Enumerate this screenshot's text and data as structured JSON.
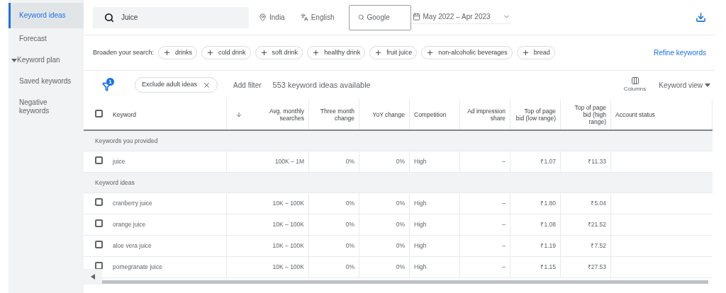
{
  "sidebar": {
    "items": [
      {
        "label": "Keyword ideas",
        "selected": true
      },
      {
        "label": "Forecast",
        "selected": false
      },
      {
        "label": "Keyword plan",
        "selected": false,
        "expanded": true
      },
      {
        "label": "Saved keywords",
        "selected": false
      },
      {
        "label": "Negative keywords",
        "selected": false
      }
    ]
  },
  "top_bar": {
    "search": {
      "value": "Juice"
    },
    "location": "India",
    "language": "English",
    "network": "Google",
    "date_range": "May 2022 – Apr 2023"
  },
  "broaden": {
    "label": "Broaden your search:",
    "chips": [
      "drinks",
      "cold drink",
      "soft drink",
      "healthy drink",
      "fruit juice",
      "non-alcoholic beverages",
      "bread"
    ],
    "refine": "Refine keywords"
  },
  "filter_bar": {
    "filter_count": "1",
    "chip": "Exclude adult ideas",
    "add_filter": "Add filter",
    "summary": "553 keyword ideas available",
    "columns": "Columns",
    "view": "Keyword view"
  },
  "table": {
    "select_all": {
      "checked": false
    },
    "columns": [
      "Keyword",
      "Avg. monthly searches",
      "Three month change",
      "YoY change",
      "Competition",
      "Ad impression share",
      "Top of page bid (low range)",
      "Top of page bid (high range)",
      "Account status"
    ],
    "rows": [
      {
        "kind": "group",
        "label": "Keywords you provided"
      },
      {
        "kind": "keyword",
        "checked": false,
        "cells": [
          "juice",
          "100K – 1M",
          "0%",
          "0%",
          "High",
          "–",
          "₹1.07",
          "₹11.33"
        ]
      },
      {
        "kind": "group",
        "label": "Keyword ideas"
      },
      {
        "kind": "keyword",
        "checked": false,
        "cells": [
          "cranberry juice",
          "10K – 100K",
          "0%",
          "0%",
          "High",
          "–",
          "₹1.80",
          "₹5.04"
        ]
      },
      {
        "kind": "keyword",
        "checked": false,
        "cells": [
          "orange juice",
          "10K – 100K",
          "0%",
          "0%",
          "High",
          "–",
          "₹1.08",
          "₹21.52"
        ]
      },
      {
        "kind": "keyword",
        "checked": false,
        "cells": [
          "aloe vera juice",
          "10K – 100K",
          "0%",
          "0%",
          "High",
          "–",
          "₹1.19",
          "₹7.52"
        ]
      },
      {
        "kind": "keyword",
        "checked": false,
        "cells": [
          "pomegranate juice",
          "10K – 100K",
          "0%",
          "0%",
          "High",
          "–",
          "₹1.15",
          "₹27.53"
        ]
      }
    ]
  }
}
